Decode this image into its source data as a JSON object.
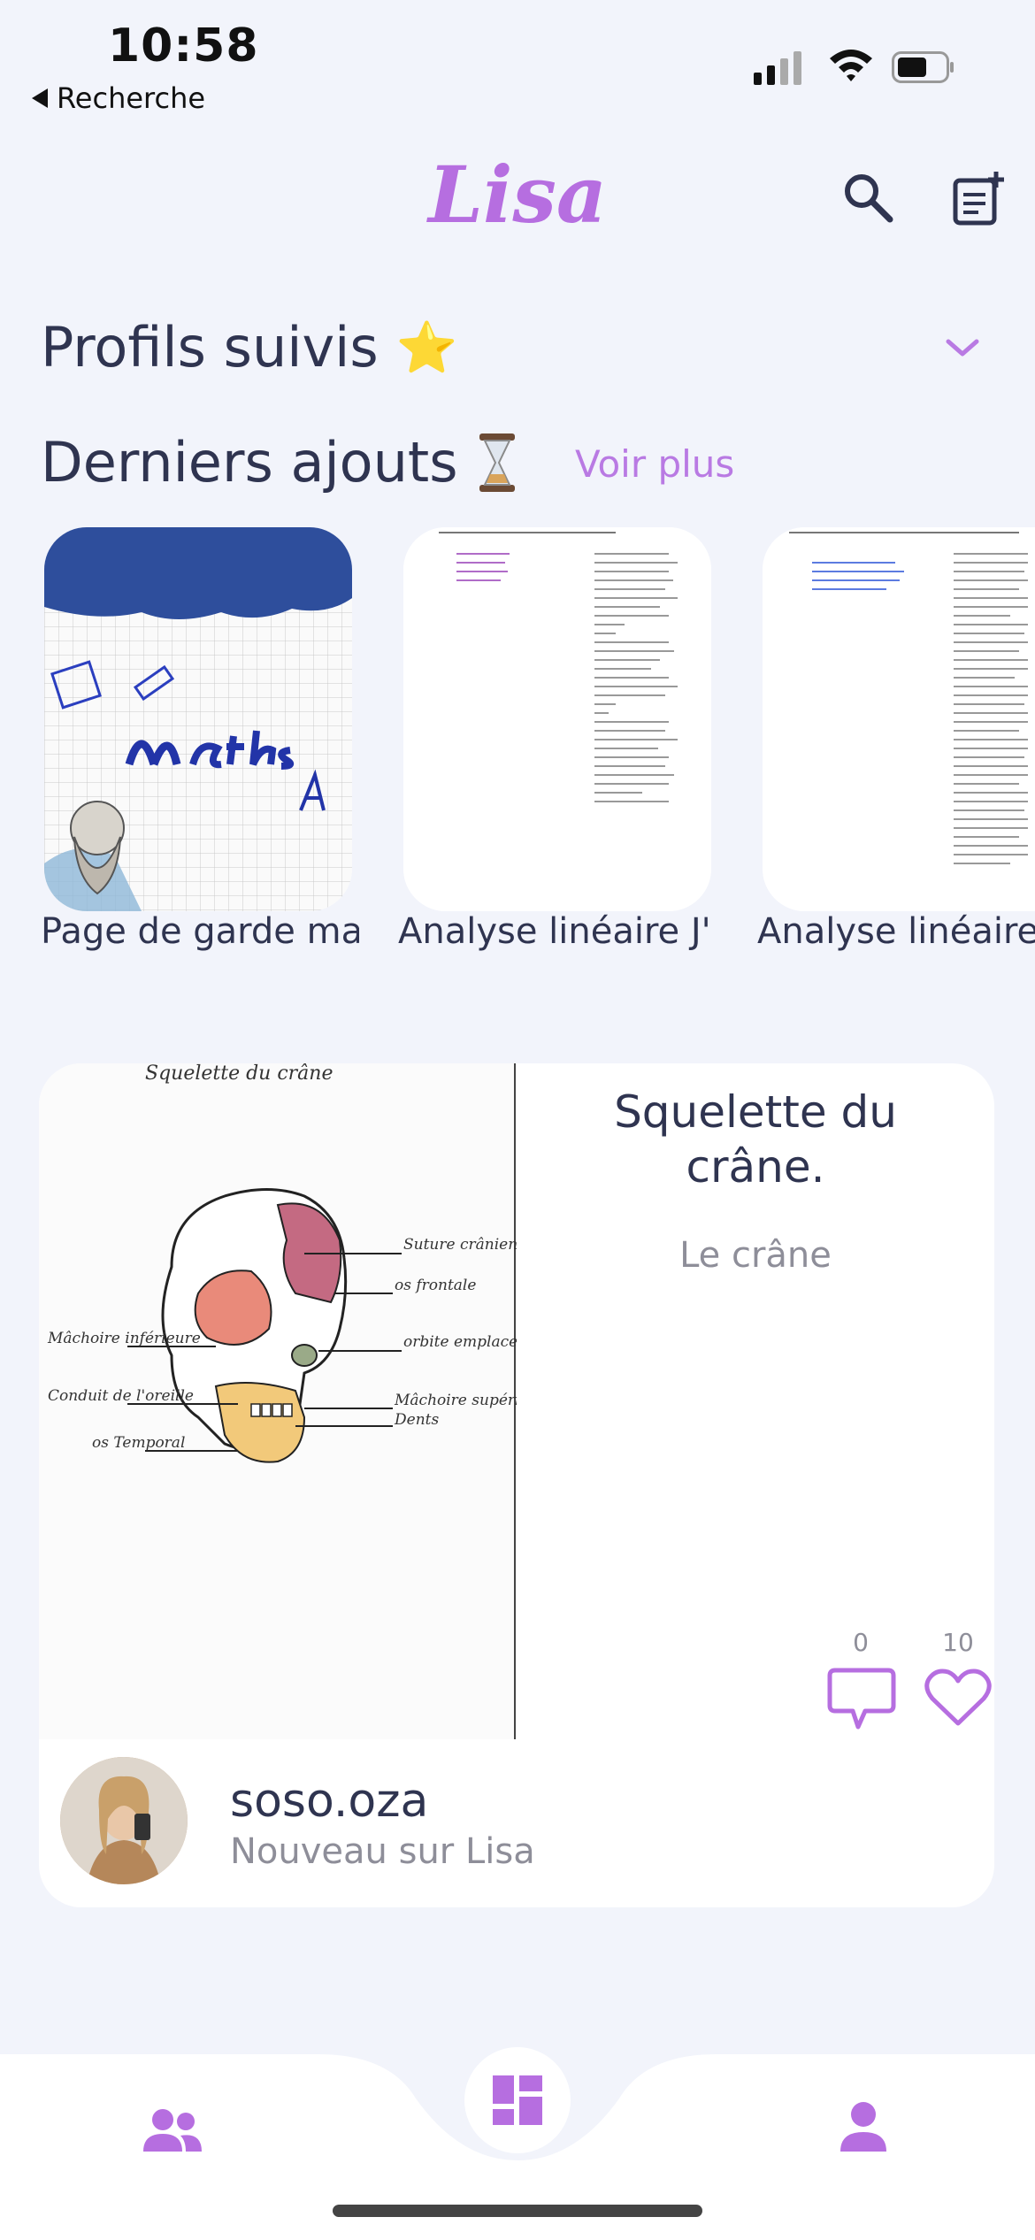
{
  "status_bar": {
    "time": "10:58",
    "back_label": "Recherche"
  },
  "header": {
    "brand": "Lisa",
    "icons": [
      "search-icon",
      "new-note-icon"
    ]
  },
  "profils_suivis": {
    "title": "Profils suivis",
    "emoji": "⭐",
    "chevron": "chevron-down-icon"
  },
  "derniers_ajouts": {
    "title": "Derniers ajouts",
    "emoji": "⏳",
    "voir_plus": "Voir plus",
    "items": [
      {
        "label": "Page de garde ma"
      },
      {
        "label": "Analyse linéaire J'"
      },
      {
        "label": "Analyse linéaire"
      }
    ]
  },
  "post": {
    "image_caption": "Squelette du crâne",
    "diagram_labels": [
      "Suture crânienne",
      "os frontale",
      "orbite emplacement du nez",
      "Mâchoire supérieure",
      "Dents",
      "Mâchoire inférieure",
      "Conduit de l'oreille",
      "os Temporal"
    ],
    "title": "Squelette du crâne.",
    "subtitle": "Le crâne",
    "comments_count": "0",
    "likes_count": "10",
    "author": {
      "name": "soso.oza",
      "status": "Nouveau sur Lisa"
    }
  },
  "tab_bar": {
    "items": [
      "people-icon",
      "dashboard-icon",
      "person-icon"
    ]
  },
  "colors": {
    "accent": "#b66ee0",
    "background": "#f2f4fb",
    "text": "#2f3450",
    "muted": "#8e8e99"
  }
}
